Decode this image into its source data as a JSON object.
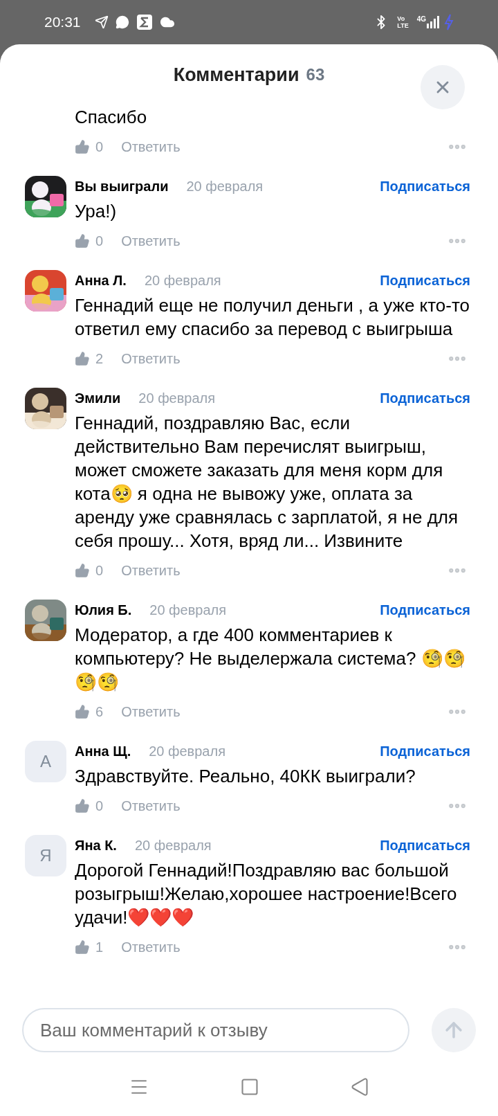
{
  "status_bar": {
    "time": "20:31",
    "volte": [
      "Vo",
      "LTE"
    ],
    "network": "4G"
  },
  "header": {
    "title": "Комментарии",
    "count": "63"
  },
  "comments": [
    {
      "partial": true,
      "text": "Спасибо",
      "likes": "0",
      "reply": "Ответить"
    },
    {
      "name": "Вы выиграли",
      "date": "20 февраля",
      "subscribe": "Подписаться",
      "text": "Ура!)",
      "likes": "0",
      "reply": "Ответить"
    },
    {
      "name": "Анна Л.",
      "date": "20 февраля",
      "subscribe": "Подписаться",
      "text": "Геннадий еще не получил деньги , а уже кто-то ответил ему спасибо за перевод с выигрыша",
      "likes": "2",
      "reply": "Ответить"
    },
    {
      "name": "Эмили",
      "date": "20 февраля",
      "subscribe": "Подписаться",
      "text": "Геннадий, поздравляю Вас, если действительно Вам перечислят выигрыш, может сможете заказать для меня корм для кота🥺 я одна не вывожу уже, оплата за аренду уже сравнялась с зарплатой, я не для себя прошу... Хотя, вряд ли... Извините",
      "likes": "0",
      "reply": "Ответить"
    },
    {
      "name": "Юлия Б.",
      "date": "20 февраля",
      "subscribe": "Подписаться",
      "text": "Модератор, а где 400 комментариев к компьютеру? Не выделержала система? 🧐🧐🧐🧐",
      "likes": "6",
      "reply": "Ответить"
    },
    {
      "avatar": {
        "kind": "letter",
        "letter": "А"
      },
      "name": "Анна Щ.",
      "date": "20 февраля",
      "subscribe": "Подписаться",
      "text": "Здравствуйте. Реально, 40КК выиграли?",
      "likes": "0",
      "reply": "Ответить"
    },
    {
      "avatar": {
        "kind": "letter",
        "letter": "Я"
      },
      "name": "Яна К.",
      "date": "20 февраля",
      "subscribe": "Подписаться",
      "text": "Дорогой Геннадий!Поздравляю вас большой розыгрыш!Желаю,хорошее настроение!Всего удачи!❤️❤️❤️",
      "likes": "1",
      "reply": "Ответить"
    }
  ],
  "composer": {
    "placeholder": "Ваш комментарий к отзыву"
  }
}
